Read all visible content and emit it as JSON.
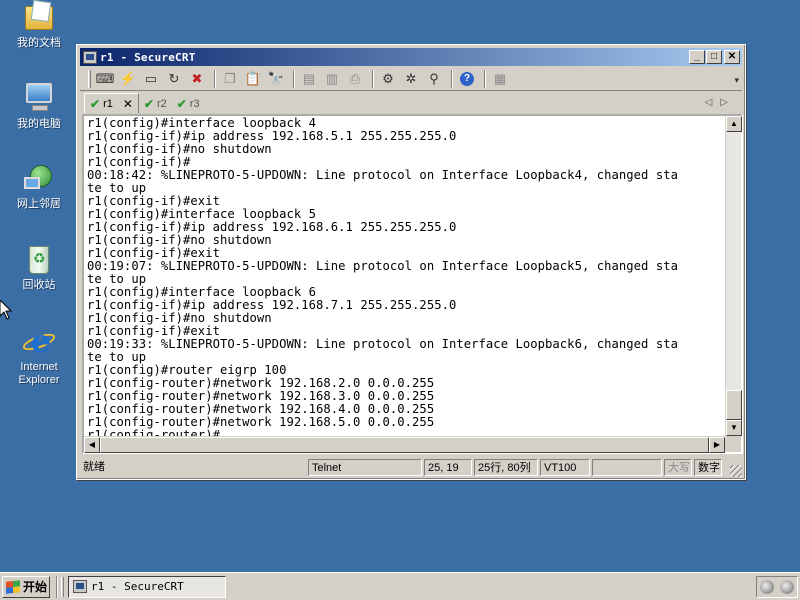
{
  "desktop": {
    "icons": [
      {
        "label": "我的文档",
        "icon": "my-documents-icon"
      },
      {
        "label": "我的电脑",
        "icon": "my-computer-icon"
      },
      {
        "label": "网上邻居",
        "icon": "network-places-icon"
      },
      {
        "label": "回收站",
        "icon": "recycle-bin-icon"
      },
      {
        "label": "Internet\nExplorer",
        "line1": "Internet",
        "line2": "Explorer",
        "icon": "internet-explorer-icon"
      }
    ]
  },
  "window": {
    "title": "r1 - SecureCRT",
    "buttons": {
      "minimize": "_",
      "maximize": "□",
      "close": "✕"
    }
  },
  "toolbar": {
    "icons": [
      "connect-icon",
      "quick-connect-icon",
      "connect-tab-icon",
      "reconnect-icon",
      "disconnect-icon",
      "copy-icon",
      "paste-icon",
      "find-icon",
      "print-icon",
      "print-selection-icon",
      "print-setup-icon",
      "session-options-icon",
      "global-options-icon",
      "keymap-icon",
      "help-icon",
      "sftp-icon"
    ]
  },
  "tabs": [
    {
      "label": "r1",
      "active": true
    },
    {
      "label": "r2",
      "active": false
    },
    {
      "label": "r3",
      "active": false
    }
  ],
  "terminal": {
    "lines": [
      "r1(config)#interface loopback 4",
      "r1(config-if)#ip address 192.168.5.1 255.255.255.0",
      "r1(config-if)#no shutdown",
      "r1(config-if)#",
      "00:18:42: %LINEPROTO-5-UPDOWN: Line protocol on Interface Loopback4, changed sta",
      "te to up",
      "r1(config-if)#exit",
      "r1(config)#interface loopback 5",
      "r1(config-if)#ip address 192.168.6.1 255.255.255.0",
      "r1(config-if)#no shutdown",
      "r1(config-if)#exit",
      "00:19:07: %LINEPROTO-5-UPDOWN: Line protocol on Interface Loopback5, changed sta",
      "te to up",
      "r1(config)#interface loopback 6",
      "r1(config-if)#ip address 192.168.7.1 255.255.255.0",
      "r1(config-if)#no shutdown",
      "r1(config-if)#exit",
      "00:19:33: %LINEPROTO-5-UPDOWN: Line protocol on Interface Loopback6, changed sta",
      "te to up",
      "r1(config)#router eigrp 100",
      "r1(config-router)#network 192.168.2.0 0.0.0.255",
      "r1(config-router)#network 192.168.3.0 0.0.0.255",
      "r1(config-router)#network 192.168.4.0 0.0.0.255",
      "r1(config-router)#network 192.168.5.0 0.0.0.255",
      "r1(config-router)#"
    ]
  },
  "statusbar": {
    "ready": "就绪",
    "protocol": "Telnet",
    "cursor_pos": "25, 19",
    "size": "25行, 80列",
    "emulation": "VT100",
    "caps": "大写",
    "num": "数字"
  },
  "taskbar": {
    "start_label": "开始",
    "task_label": "r1 - SecureCRT"
  }
}
